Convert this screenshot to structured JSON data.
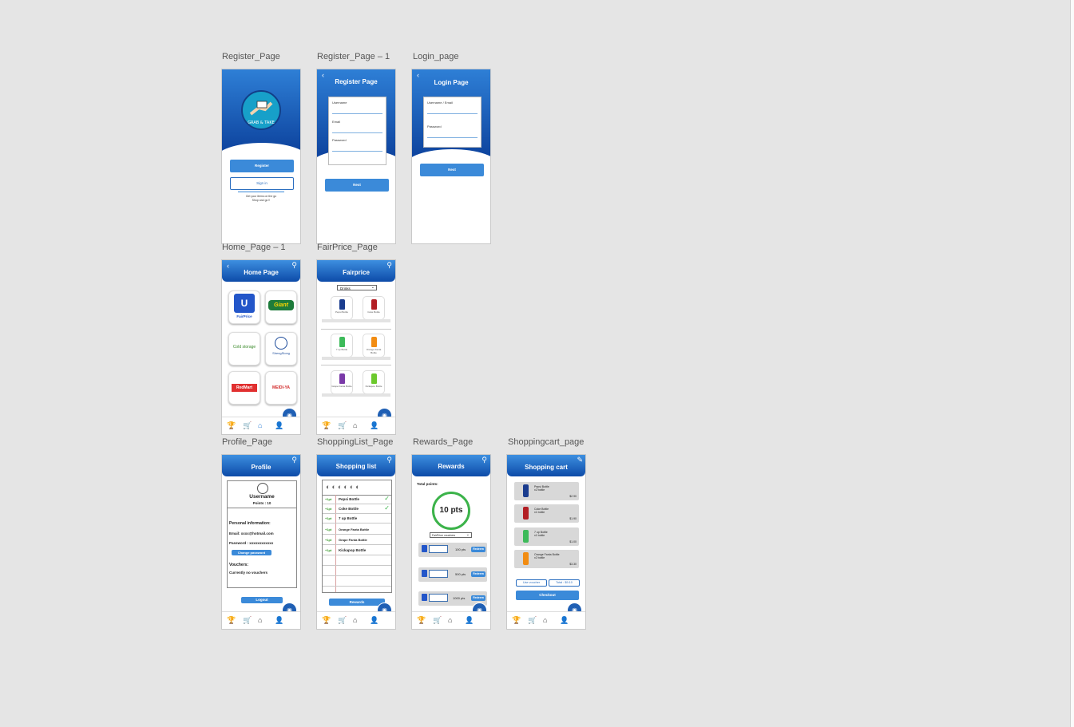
{
  "artboards": {
    "register": "Register_Page",
    "register1": "Register_Page – 1",
    "login": "Login_page",
    "home": "Home_Page – 1",
    "fairprice": "FairPrice_Page",
    "profile": "Profile_Page",
    "shoppinglist": "ShoppingList_Page",
    "rewards": "Rewards_Page",
    "cart": "Shoppingcart_page"
  },
  "register_page": {
    "register_btn": "Register",
    "signin_btn": "Sign in",
    "tagline_1": "Get your items on the go",
    "tagline_2": "Shop and go !!"
  },
  "register_page_1": {
    "title": "Register Page",
    "username": "Username",
    "email": "Email",
    "password": "Password",
    "next_btn": "Next"
  },
  "login_page": {
    "title": "Login Page",
    "username": "Username / Email",
    "password": "Password",
    "next_btn": "Next"
  },
  "home_page": {
    "title": "Home Page",
    "stores": [
      "FairPrice",
      "Giant",
      "Cold storage",
      "ShengSiong",
      "RedMart",
      "MEIDI-YA"
    ]
  },
  "fairprice_page": {
    "title": "Fairprice",
    "category": "Drinks",
    "products": [
      "Pepsi Bottle",
      "Coke Bottle",
      "7 up Bottle",
      "Orange Fanta Bottle",
      "Grape Fanta Bottle",
      "Kickapoo Bottle"
    ]
  },
  "profile_page": {
    "title": "Profile",
    "username": "Username",
    "points": "Points : 10",
    "personal_info": "Personal information:",
    "email": "Email: xxxx@hotmail.com",
    "password": "Password : xxxxxxxxxxxx",
    "change_password": "Change password",
    "vouchers": "Vouchers:",
    "no_vouchers": "Currently no vouchers",
    "logout": "Logout"
  },
  "shoppinglist_page": {
    "title": "Shopping list",
    "items": [
      {
        "points": "+1pt",
        "name": "Pepsi Bottle",
        "checked": true
      },
      {
        "points": "+1pt",
        "name": "Coke Bottle",
        "checked": true
      },
      {
        "points": "+1pt",
        "name": "7 up Bottle",
        "checked": false
      },
      {
        "points": "+1pt",
        "name": "Orange Fanta Bottle",
        "checked": false
      },
      {
        "points": "+1pt",
        "name": "Grape Fanta Bottle",
        "checked": false
      },
      {
        "points": "+1pt",
        "name": "Kickapop Bottle",
        "checked": false
      }
    ],
    "rewards_btn": "Rewards"
  },
  "rewards_page": {
    "title": "Rewards",
    "total_label": "Total points:",
    "points": "10 pts",
    "dropdown": "FairPrice vouchers",
    "vouchers": [
      {
        "cost": "100 pts",
        "btn": "Redeem"
      },
      {
        "cost": "500 pts",
        "btn": "Redeem"
      },
      {
        "cost": "1000 pts",
        "btn": "Redeem"
      }
    ]
  },
  "cart_page": {
    "title": "Shopping cart",
    "items": [
      {
        "name": "Pepsi Bottle",
        "qty": "x2 bottle",
        "price": "$2.90"
      },
      {
        "name": "Coke Bottle",
        "qty": "x1 bottle",
        "price": "$1.90"
      },
      {
        "name": "7 up Bottle",
        "qty": "x1 bottle",
        "price": "$1.00"
      },
      {
        "name": "Orange Fanta Bottle",
        "qty": "x2 bottle",
        "price": "$3.30"
      }
    ],
    "use_voucher": "Use voucher",
    "total": "Total : $9.10",
    "checkout": "Checkout"
  },
  "colors": {
    "primary": "#3b8ad9",
    "header_dark": "#0b3f9a",
    "check_green": "#3cb34a",
    "canvas": "#e5e5e5"
  },
  "icons": {
    "nav": [
      "trophy-icon",
      "cart-icon",
      "home-icon",
      "person-icon"
    ],
    "fab": "camera-icon",
    "header": [
      "back-icon",
      "search-icon",
      "edit-icon"
    ]
  }
}
